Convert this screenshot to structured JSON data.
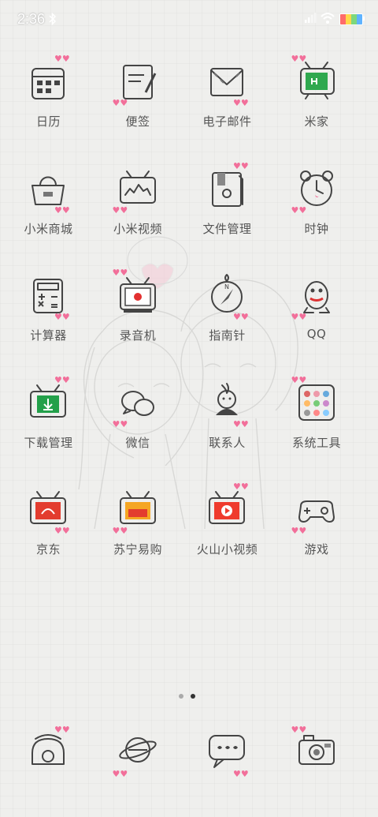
{
  "status_bar": {
    "time": "2:36",
    "battery_colors": [
      "#ff6b6b",
      "#ffd84a",
      "#7dd87d",
      "#5fb3ff"
    ]
  },
  "apps": [
    {
      "label": "日历",
      "icon": "calendar-icon"
    },
    {
      "label": "便签",
      "icon": "notes-icon"
    },
    {
      "label": "电子邮件",
      "icon": "email-icon"
    },
    {
      "label": "米家",
      "icon": "mijia-icon"
    },
    {
      "label": "小米商城",
      "icon": "mi-store-icon"
    },
    {
      "label": "小米视频",
      "icon": "mi-video-icon"
    },
    {
      "label": "文件管理",
      "icon": "file-manager-icon"
    },
    {
      "label": "时钟",
      "icon": "clock-icon"
    },
    {
      "label": "计算器",
      "icon": "calculator-icon"
    },
    {
      "label": "录音机",
      "icon": "recorder-icon"
    },
    {
      "label": "指南针",
      "icon": "compass-icon"
    },
    {
      "label": "QQ",
      "icon": "qq-icon"
    },
    {
      "label": "下载管理",
      "icon": "download-icon"
    },
    {
      "label": "微信",
      "icon": "wechat-icon"
    },
    {
      "label": "联系人",
      "icon": "contacts-icon"
    },
    {
      "label": "系统工具",
      "icon": "system-tools-icon"
    },
    {
      "label": "京东",
      "icon": "jd-icon"
    },
    {
      "label": "苏宁易购",
      "icon": "suning-icon"
    },
    {
      "label": "火山小视频",
      "icon": "huoshan-icon"
    },
    {
      "label": "游戏",
      "icon": "game-icon"
    }
  ],
  "page_indicator": {
    "pages": 2,
    "active": 2
  },
  "dock": [
    {
      "icon": "phone-icon"
    },
    {
      "icon": "browser-icon"
    },
    {
      "icon": "messages-icon"
    },
    {
      "icon": "camera-icon"
    }
  ]
}
